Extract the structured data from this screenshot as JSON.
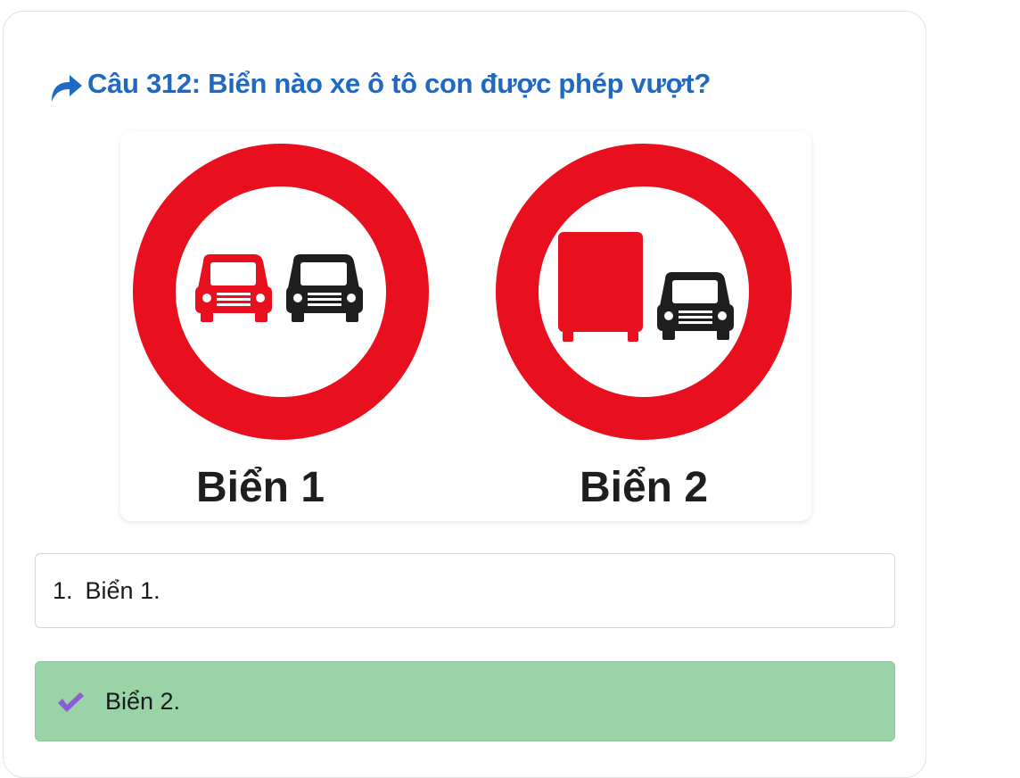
{
  "question": {
    "text": "Câu 312: Biển nào xe ô tô con được phép vượt?",
    "icon": "share-arrow-icon",
    "color": "#1f69c2"
  },
  "figure": {
    "signs": [
      {
        "label": "Biển 1",
        "depicts": [
          "red-car-icon",
          "black-car-icon"
        ]
      },
      {
        "label": "Biển 2",
        "depicts": [
          "red-truck-icon",
          "black-car-icon"
        ]
      }
    ],
    "ring_color": "#e8101e"
  },
  "options": [
    {
      "number": "1.",
      "text": "Biển 1.",
      "selected": false
    },
    {
      "icon": "checkmark-icon",
      "text": "Biển 2.",
      "selected": true,
      "highlight_color": "#9ad3a6"
    }
  ]
}
